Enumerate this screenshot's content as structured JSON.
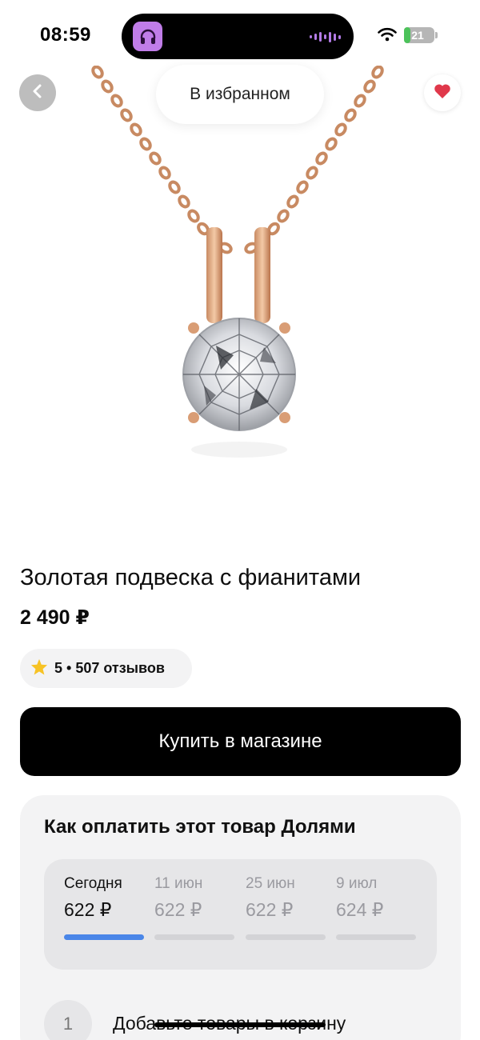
{
  "status_bar": {
    "time": "08:59",
    "battery": "21",
    "battery_level_percent": 21,
    "island_app_icon": "headphones-icon",
    "island_activity_icon": "audio-wave-icon",
    "wifi_icon": "wifi-icon"
  },
  "hero": {
    "image_icon": "pendant-product-image",
    "back_icon": "chevron-left-icon",
    "favorite_icon": "heart-icon",
    "favorite_toast": "В избранном"
  },
  "product": {
    "title": "Золотая подвеска с фианитами",
    "price": "2 490 ₽",
    "rating_icon": "star-icon",
    "rating": "5 • 507 отзывов",
    "buy_label": "Купить в магазине"
  },
  "dolyami": {
    "title": "Как оплатить этот товар Долями",
    "installments": [
      {
        "date": "Сегодня",
        "amount": "622 ₽",
        "active": true
      },
      {
        "date": "11 июн",
        "amount": "622 ₽",
        "active": false
      },
      {
        "date": "25 июн",
        "amount": "622 ₽",
        "active": false
      },
      {
        "date": "9 июл",
        "amount": "624 ₽",
        "active": false
      }
    ],
    "step_number": "1",
    "step_text": "Добавьте товары в корзину"
  },
  "colors": {
    "accent": "#4a86e8",
    "heart": "#e0384b",
    "buy_button": "#000000",
    "card_bg": "#f3f3f4"
  }
}
